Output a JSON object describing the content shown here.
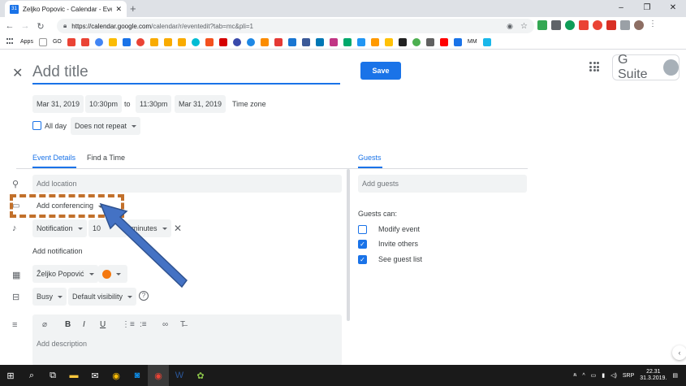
{
  "browser": {
    "tab_title": "Zeljko Popovic - Calendar - Eve",
    "tab_favicon": "31",
    "new_tab": "+",
    "window_controls": [
      "–",
      "❐",
      "✕"
    ],
    "url_host": "https://calendar.google.com",
    "url_path": "/calendar/r/eventedit?tab=mc&pli=1",
    "bookmarks": [
      "Apps",
      "GO",
      "MM"
    ]
  },
  "event": {
    "title_placeholder": "Add title",
    "save_label": "Save",
    "start_date": "Mar 31, 2019",
    "start_time": "10:30pm",
    "to_label": "to",
    "end_time": "11:30pm",
    "end_date": "Mar 31, 2019",
    "timezone_label": "Time zone",
    "allday_label": "All day",
    "repeat_label": "Does not repeat"
  },
  "gsuite": {
    "label": "G Suite"
  },
  "tabs": {
    "event_details": "Event Details",
    "find_time": "Find a Time"
  },
  "details": {
    "location_placeholder": "Add location",
    "conferencing_label": "Add conferencing",
    "notification_type": "Notification",
    "notification_value": "10",
    "notification_unit": "minutes",
    "add_notification": "Add notification",
    "calendar_owner": "Željko Popović",
    "busy_label": "Busy",
    "visibility_label": "Default visibility",
    "description_placeholder": "Add description"
  },
  "guests": {
    "title": "Guests",
    "add_placeholder": "Add guests",
    "can_label": "Guests can:",
    "permissions": [
      {
        "label": "Modify event",
        "checked": false
      },
      {
        "label": "Invite others",
        "checked": true
      },
      {
        "label": "See guest list",
        "checked": true
      }
    ]
  },
  "taskbar": {
    "time": "22.31",
    "date": "31.3.2019.",
    "lang": "SRP"
  },
  "colors": {
    "accent": "#1a73e8",
    "event_color": "#f4780f",
    "annotation_dashes": "#c2702b",
    "annotation_arrow": "#4472c4"
  }
}
